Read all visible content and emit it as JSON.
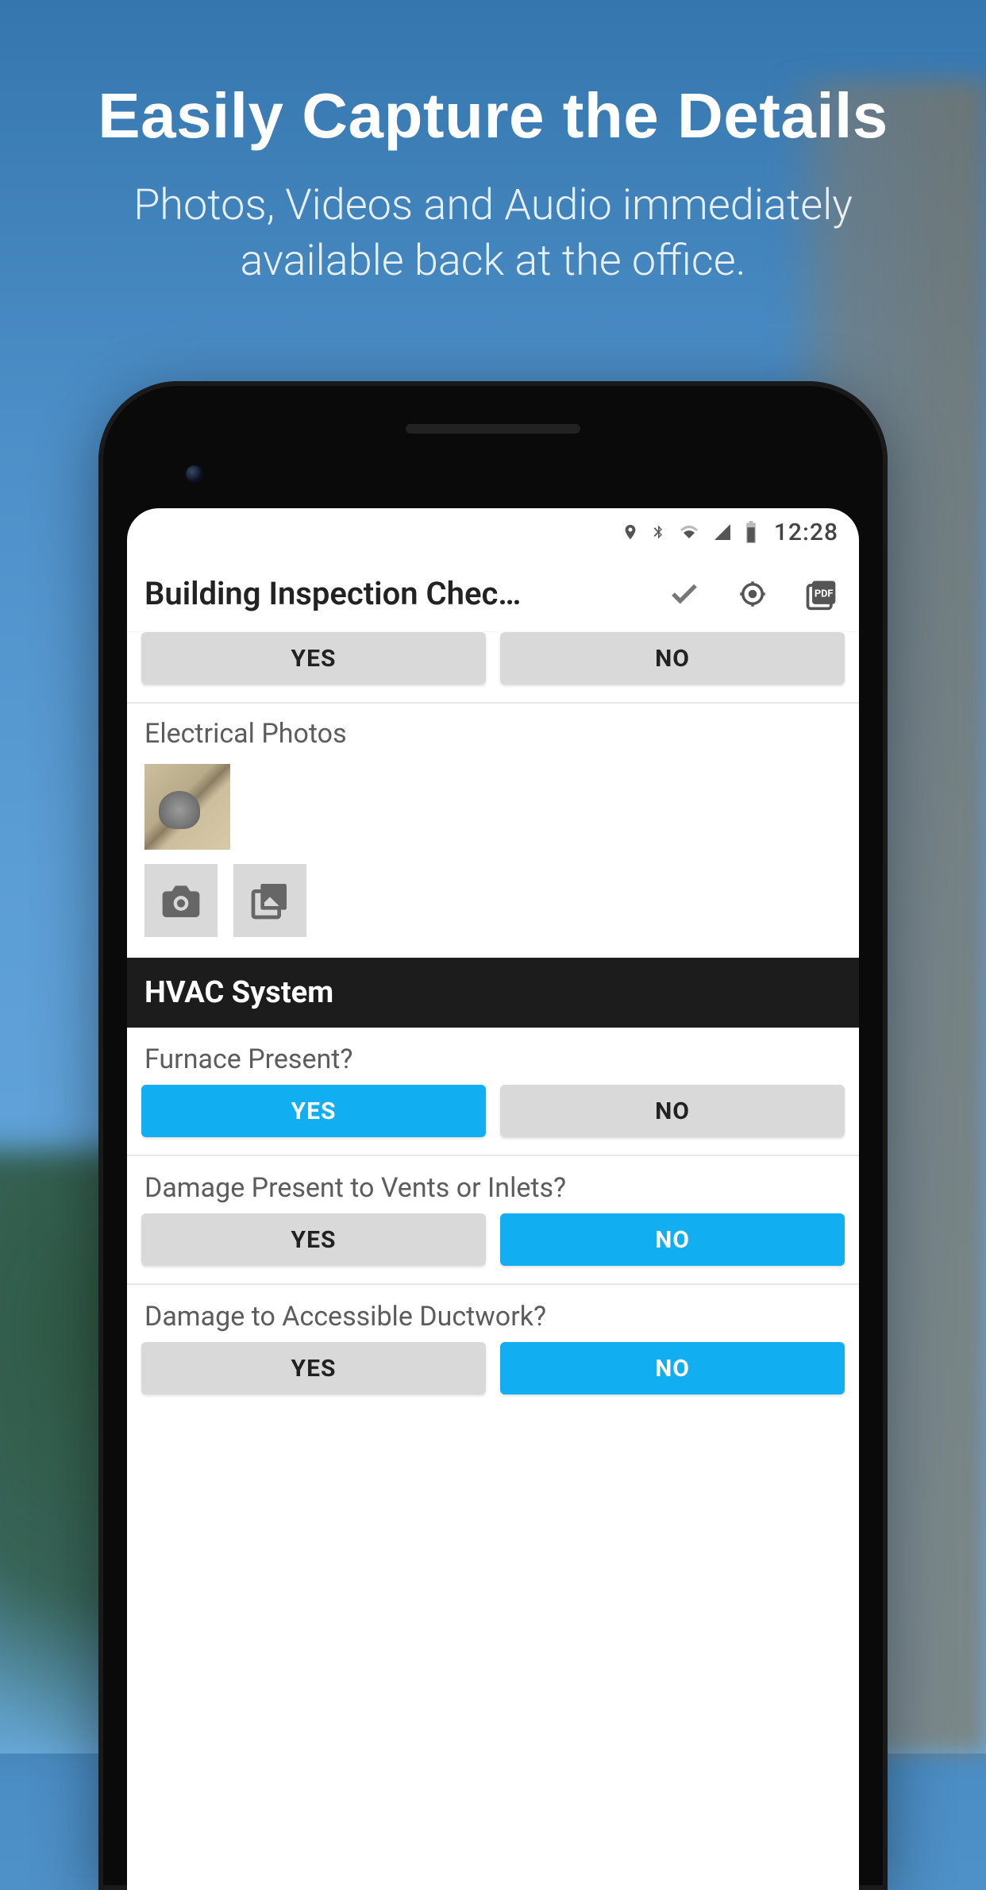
{
  "hero": {
    "title": "Easily Capture the Details",
    "subtitle_line1": "Photos, Videos and Audio immediately",
    "subtitle_line2": "available back at the office."
  },
  "status": {
    "time": "12:28"
  },
  "appbar": {
    "title": "Building Inspection Chec…"
  },
  "row_top": {
    "yes": "YES",
    "no": "NO"
  },
  "electrical": {
    "label": "Electrical Photos"
  },
  "hvac": {
    "header": "HVAC System",
    "q1": {
      "label": "Furnace Present?",
      "yes": "YES",
      "no": "NO"
    },
    "q2": {
      "label": "Damage Present to Vents or Inlets?",
      "yes": "YES",
      "no": "NO"
    },
    "q3": {
      "label": "Damage to Accessible Ductwork?",
      "yes": "YES",
      "no": "NO"
    }
  },
  "colors": {
    "accent": "#12aef2",
    "neutral_button": "#d9d9d9",
    "section_header": "#1c1c1c"
  }
}
